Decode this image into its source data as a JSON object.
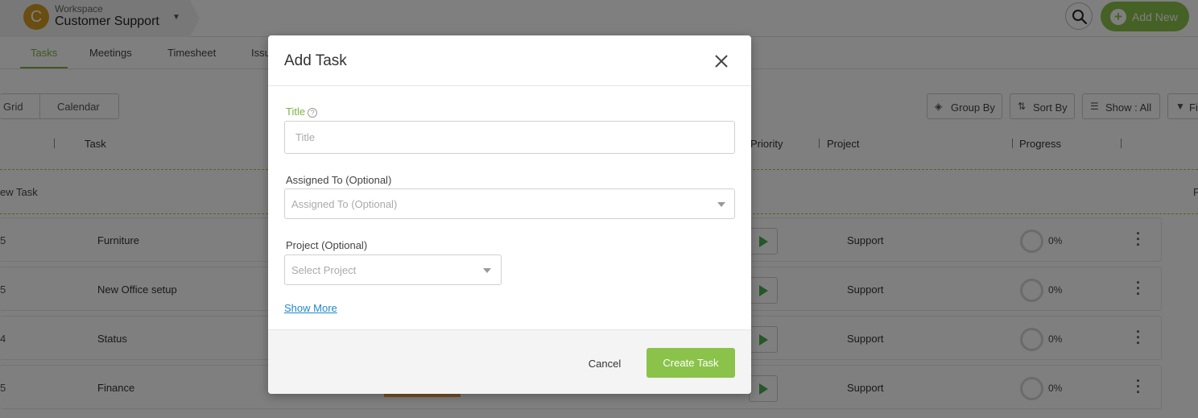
{
  "workspace": {
    "label": "Workspace",
    "name": "Customer Support",
    "avatar_letter": "C",
    "avatar_color": "#d39b23"
  },
  "header": {
    "add_new_label": "Add New",
    "accent_color": "#8bc34a"
  },
  "nav_tabs": [
    {
      "label": "Tasks",
      "active": true
    },
    {
      "label": "Meetings"
    },
    {
      "label": "Timesheet"
    },
    {
      "label": "Issu"
    }
  ],
  "view_toggle": {
    "grid": "Grid",
    "calendar": "Calendar"
  },
  "toolbar": {
    "group_by": "Group By",
    "sort_by": "Sort By",
    "show_all": "Show : All",
    "filter": "Fi"
  },
  "table": {
    "headers": {
      "task": "Task",
      "priority": "Priority",
      "project": "Project",
      "progress": "Progress"
    },
    "new_task_label": "ew Task",
    "new_task_right": "F",
    "rows": [
      {
        "num": "5",
        "name": "Furniture",
        "project": "Support",
        "progress": "0%"
      },
      {
        "num": "5",
        "name": "New Office setup",
        "project": "Support",
        "progress": "0%"
      },
      {
        "num": "4",
        "name": "Status",
        "project": "Support",
        "progress": "0%"
      },
      {
        "num": "5",
        "name": "Finance",
        "project": "Support",
        "progress": "0%"
      }
    ]
  },
  "modal": {
    "title": "Add Task",
    "title_field": {
      "label": "Title",
      "placeholder": "Title",
      "value": ""
    },
    "assigned_field": {
      "label": "Assigned To (Optional)",
      "placeholder": "Assigned To (Optional)"
    },
    "project_field": {
      "label": "Project (Optional)",
      "placeholder": "Select Project"
    },
    "show_more": "Show More",
    "cancel_label": "Cancel",
    "create_label": "Create Task"
  },
  "icons": {
    "close": "close-icon",
    "search": "search-icon",
    "plus": "plus-icon",
    "help": "help-icon",
    "caret": "chevron-down-icon",
    "layers": "layers-icon",
    "sort": "sort-icon",
    "filter": "filter-icon",
    "play": "play-icon",
    "kebab": "kebab-icon"
  }
}
